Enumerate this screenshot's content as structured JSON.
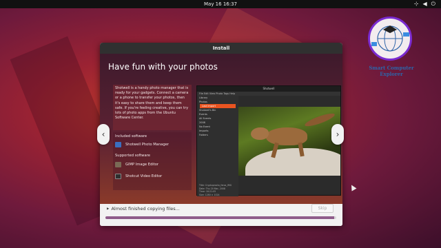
{
  "topbar": {
    "clock": "May 16  16:37",
    "tray_icons": [
      "network-icon",
      "volume-icon",
      "power-icon"
    ]
  },
  "watermark": {
    "brand_line1": "Smart Computer",
    "brand_line2": "Explorer"
  },
  "window": {
    "title": "Install",
    "slide_title": "Have fun with your photos",
    "description": "Shotwell is a handy photo manager that is ready for your gadgets. Connect a camera or a phone to transfer your photos, then it's easy to share them and keep them safe. If you're feeling creative, you can try lots of photo apps from the Ubuntu Software Center.",
    "included_label": "Included software",
    "included": [
      {
        "name": "Shotwell Photo Manager",
        "icon": "shotwell-icon",
        "color": "#3a6fbf"
      }
    ],
    "supported_label": "Supported software",
    "supported": [
      {
        "name": "GIMP Image Editor",
        "icon": "gimp-icon",
        "color": "#7a6a55"
      },
      {
        "name": "Shotcut Video Editor",
        "icon": "shotcut-icon",
        "color": "#2e2e2e"
      }
    ],
    "shotwell": {
      "title": "Shotwell",
      "menu": "File  Edit  View  Photo  Tags  Help",
      "library": [
        "Library",
        "Photos",
        "Last Import",
        "Shotwell's Bin",
        "Events",
        "All Events",
        "2008",
        "No Event",
        "Imports",
        "Folders"
      ],
      "info": [
        "Title: Cryptoprocta_ferox_IMG",
        "Date: Thu 20 Mar, 2008",
        "Time: 16:21:05",
        "Size: 1280 × 1024"
      ]
    },
    "status_text": "Almost finished copying files...",
    "skip_label": "Skip",
    "progress": 0.99,
    "accent_color": "#8e5c8a"
  }
}
